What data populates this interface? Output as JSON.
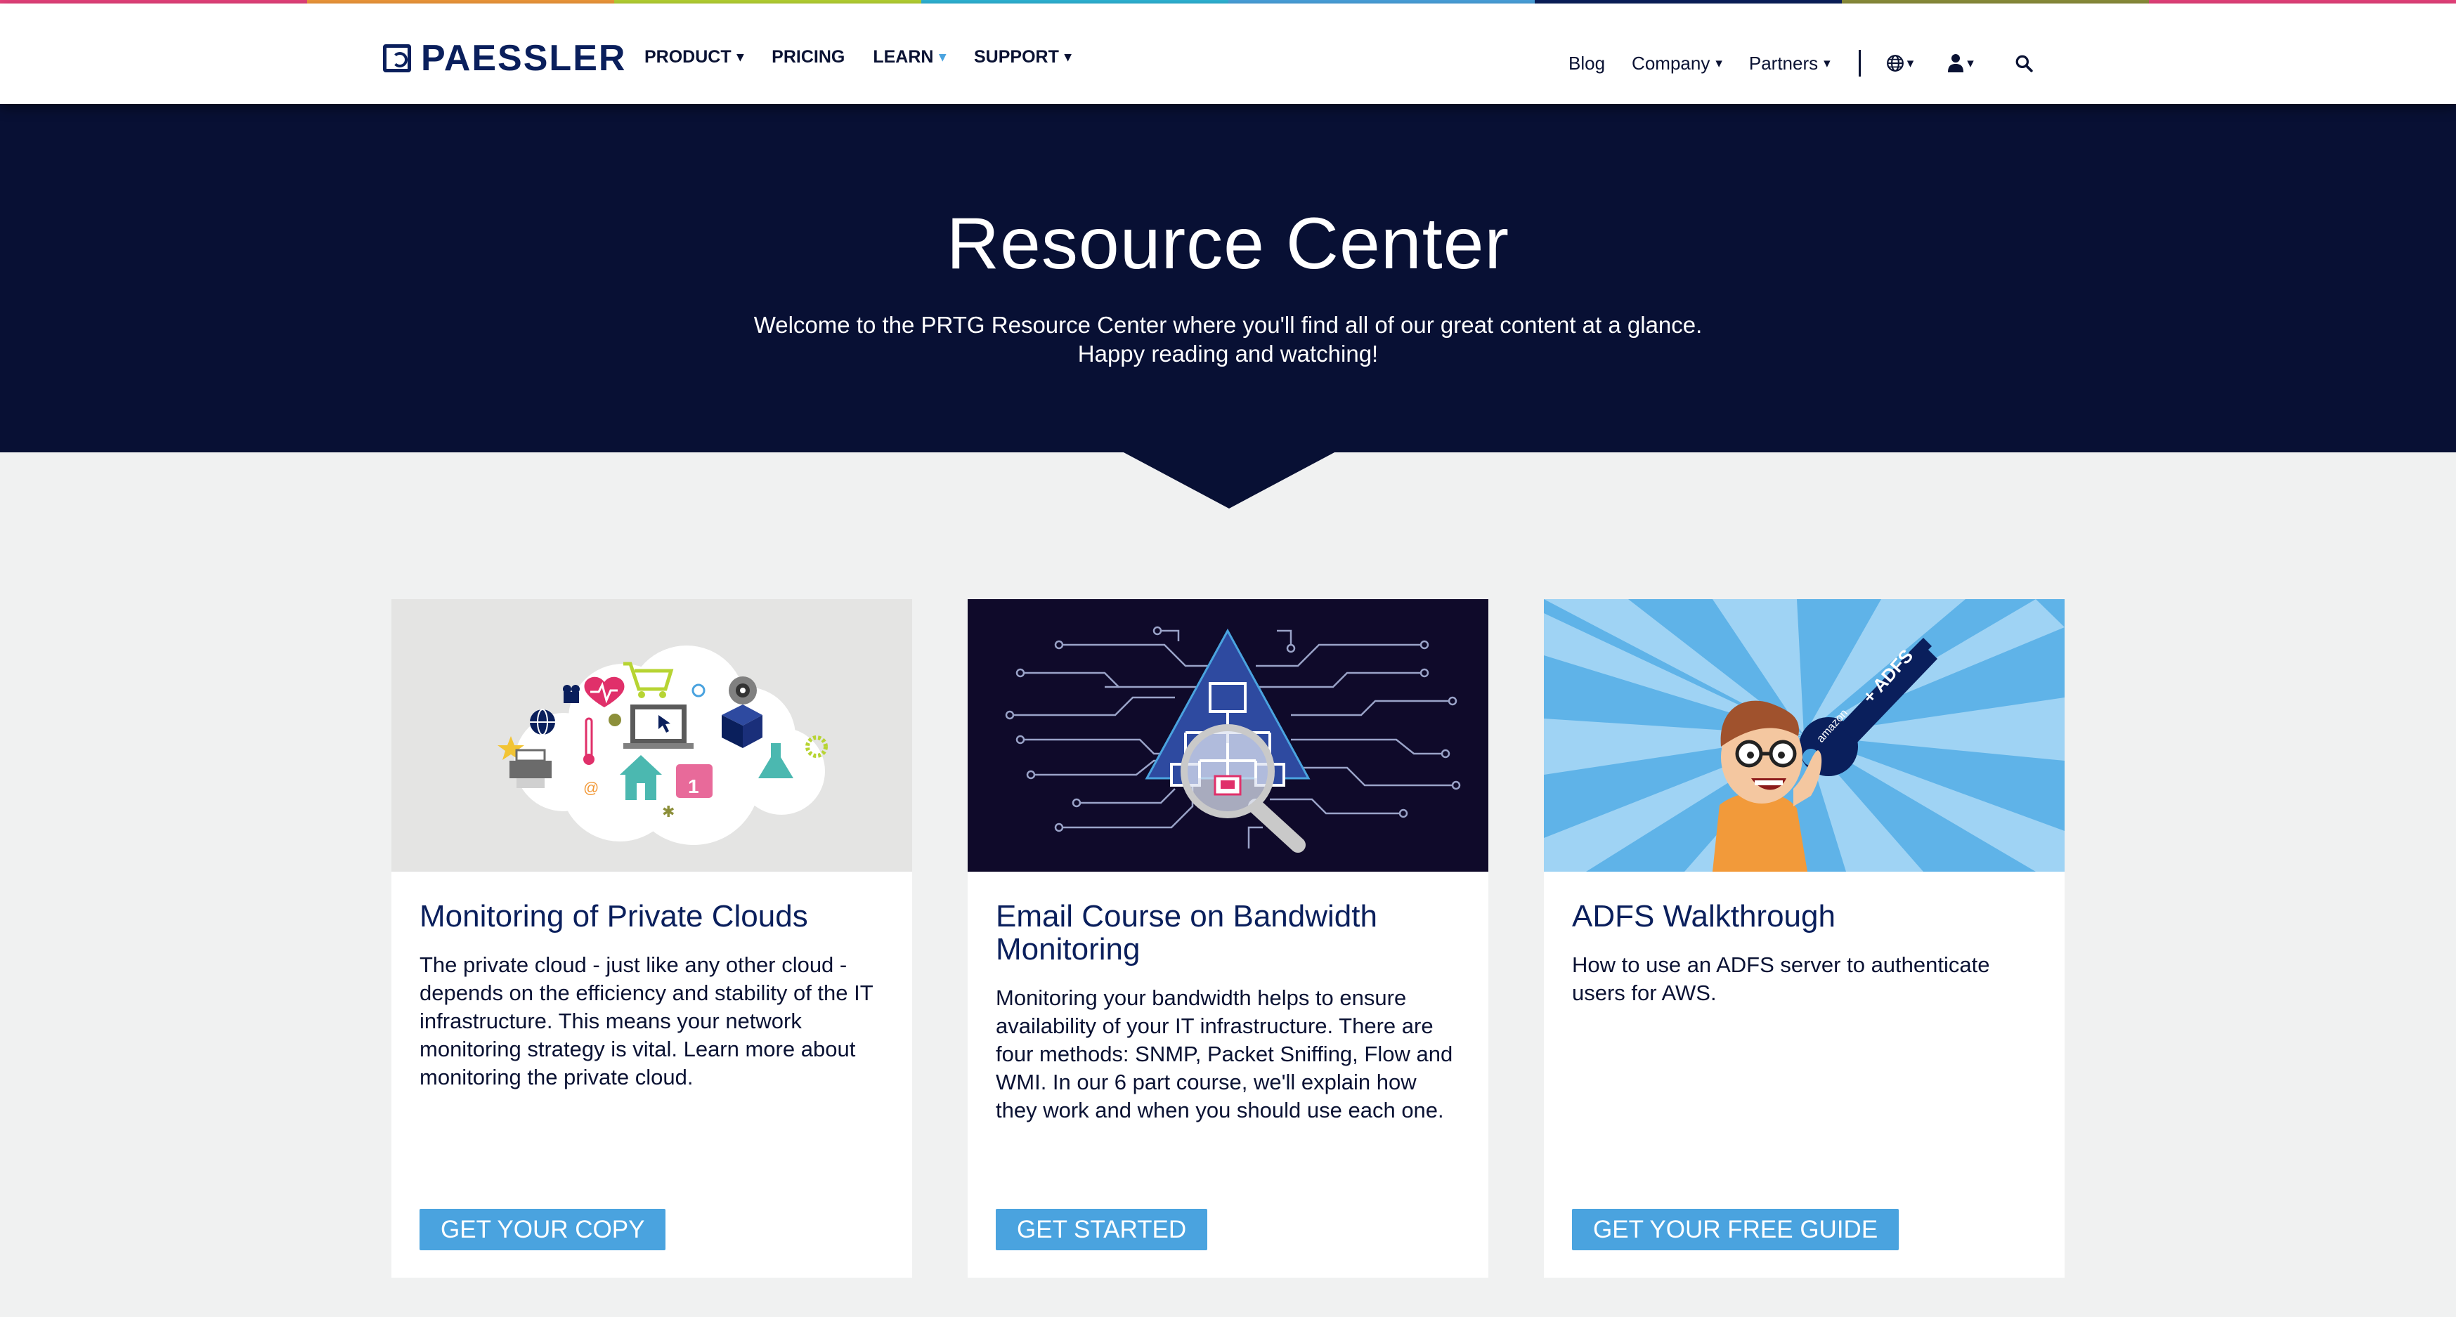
{
  "nav": {
    "logo": "PAESSLER",
    "main": [
      {
        "label": "PRODUCT",
        "caret": "▾"
      },
      {
        "label": "PRICING",
        "caret": ""
      },
      {
        "label": "LEARN",
        "caret": "▾"
      },
      {
        "label": "SUPPORT",
        "caret": "▾"
      }
    ],
    "right": [
      {
        "label": "Blog",
        "caret": ""
      },
      {
        "label": "Company",
        "caret": "▾"
      },
      {
        "label": "Partners",
        "caret": "▾"
      }
    ],
    "icons": {
      "globe": "globe-icon",
      "user": "user-icon",
      "search": "search-icon"
    },
    "caret_glyph": "▾"
  },
  "hero": {
    "title": "Resource Center",
    "subtitle_line1": "Welcome to the PRTG Resource Center where you'll find all of our great content at a glance.",
    "subtitle_line2": "Happy reading and watching!"
  },
  "cards": [
    {
      "title": "Monitoring of Private Clouds",
      "text": "The private cloud - just like any other cloud - depends on the efficiency and stability of the IT infrastructure. This means your network monitoring strategy is vital. Learn more about monitoring the private cloud.",
      "cta": "GET YOUR COPY",
      "image": "private-cloud-illustration"
    },
    {
      "title": "Email Course on Bandwidth Monitoring",
      "text": "Monitoring your bandwidth helps to ensure availability of your IT infrastructure. There are four methods: SNMP, Packet Sniffing, Flow and WMI. In our 6 part course, we'll explain how they work and when you should use each one.",
      "cta": "GET STARTED",
      "image": "bandwidth-circuit-illustration"
    },
    {
      "title": "ADFS Walkthrough",
      "text": "How to use an ADFS server to authenticate users for AWS.",
      "cta": "GET YOUR FREE GUIDE",
      "image": "adfs-key-illustration",
      "key_label": "+ ADFS",
      "key_brand": "amazon"
    }
  ],
  "colors": {
    "navy": "#081034",
    "accent": "#4aa3df",
    "page_bg": "#f0f1f1",
    "stripe": [
      "#e8427c",
      "#f29a3a",
      "#b7d433",
      "#2fb6d8",
      "#4aa3df",
      "#0a1f5c",
      "#8c8f3a",
      "#e8427c"
    ]
  }
}
